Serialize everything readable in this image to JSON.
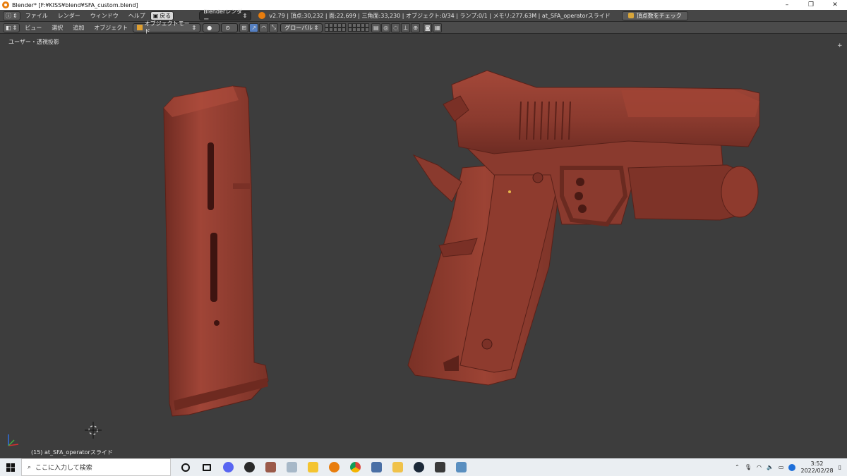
{
  "titlebar": {
    "title": "Blender* [F:¥KISS¥blend¥SFA_custom.blend]",
    "minimize_glyph": "–",
    "restore_glyph": "❐",
    "close_glyph": "✕"
  },
  "infobar": {
    "menus": [
      "ファイル",
      "レンダー",
      "ウィンドウ",
      "ヘルプ"
    ],
    "back_button": "戻る",
    "render_engine": "Blenderレンダー",
    "stats": "v2.79 | 頂点:30,232 | 面:22,699 | 三角面:33,230 | オブジェクト:0/34 | ランプ:0/1 | メモリ:277.63M | at_SFA_operatorスライド",
    "check_button": "頂点数をチェック"
  },
  "viewheader": {
    "menus": [
      "ビュー",
      "選択",
      "追加",
      "オブジェクト"
    ],
    "mode": "オブジェクトモード",
    "orientation": "グローバル"
  },
  "viewport": {
    "view_label": "ユーザー・透視投影",
    "object_label": "(15) at_SFA_operatorスライド",
    "model_color": "#8a3a2e"
  },
  "taskbar": {
    "search_placeholder": "ここに入力して検索",
    "time": "3:52",
    "date": "2022/02/28"
  }
}
